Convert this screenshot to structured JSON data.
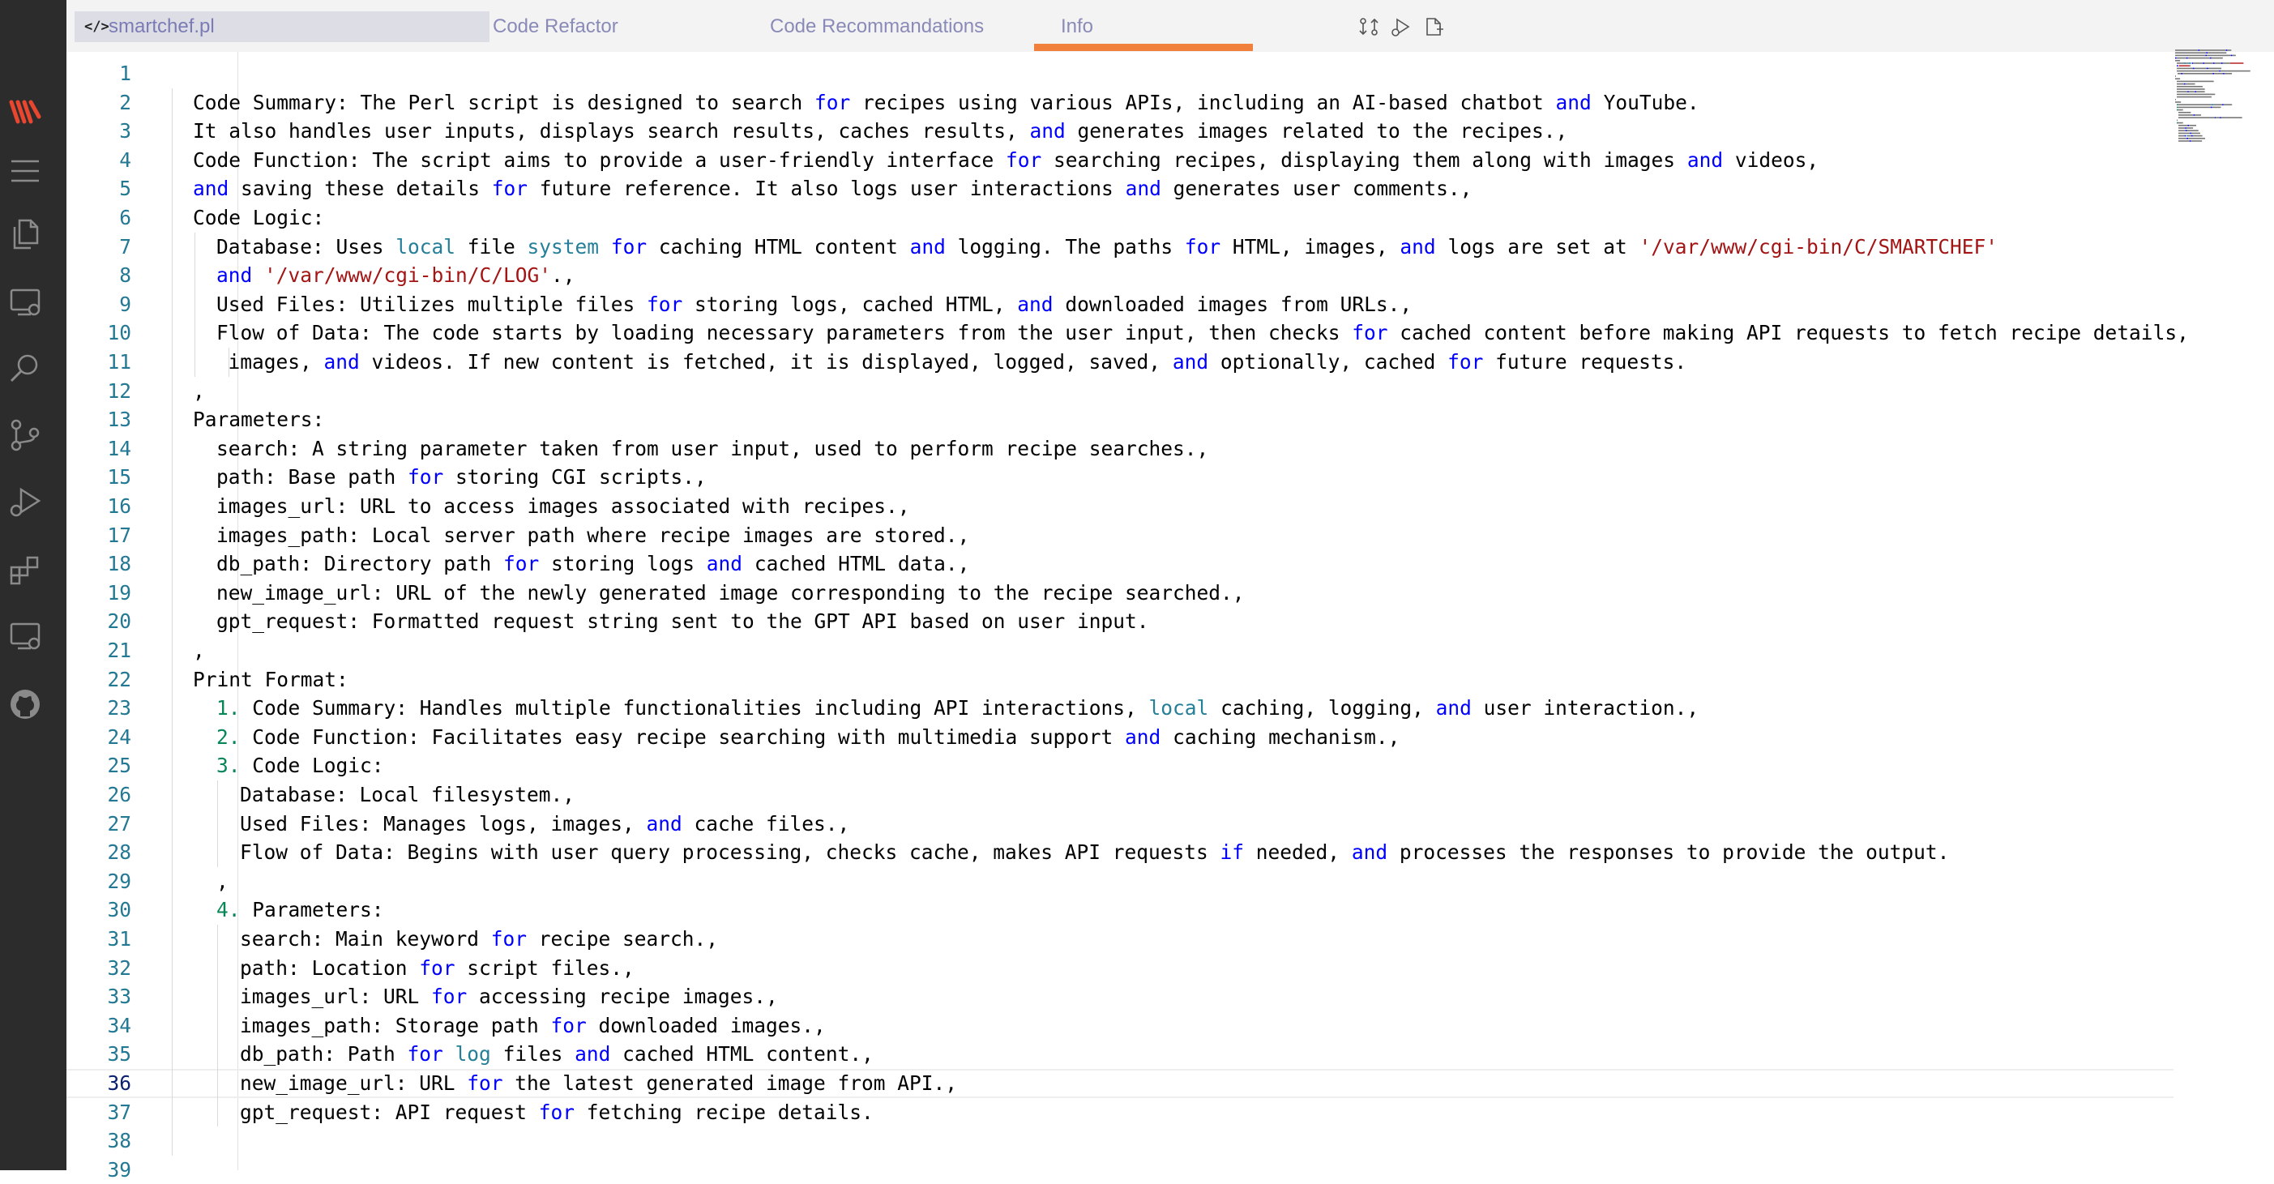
{
  "tabs": {
    "file": {
      "icon": "</>",
      "label": "smartchef.pl"
    },
    "items": [
      {
        "label": "Code Refactor"
      },
      {
        "label": "Code Recommandations"
      },
      {
        "label": "Info"
      }
    ],
    "active_index": 2
  },
  "colors": {
    "activity_bar": "#2c2c2c",
    "tab_accent": "#f0803c",
    "keyword": "#0000ff",
    "type": "#267f99",
    "string": "#a31515",
    "line_number": "#237893"
  },
  "activity_icons": [
    "logo-icon",
    "menu-icon",
    "explorer-icon",
    "remote-explorer-icon",
    "search-icon",
    "source-control-icon",
    "run-debug-icon",
    "extensions-icon",
    "remote-icon",
    "github-icon"
  ],
  "editor": {
    "current_line": 36,
    "lines": [
      {
        "n": "1",
        "i": 0,
        "t": []
      },
      {
        "n": "2",
        "i": 0,
        "t": [
          [
            "Code Summary: The Perl script is designed to search ",
            ""
          ],
          [
            "for",
            "kw"
          ],
          [
            " recipes using various APIs, including an AI-based chatbot ",
            ""
          ],
          [
            "and",
            "kw"
          ],
          [
            " YouTube.",
            ""
          ]
        ]
      },
      {
        "n": "3",
        "i": 0,
        "t": [
          [
            "It also handles user inputs, displays search results, caches results, ",
            ""
          ],
          [
            "and",
            "kw"
          ],
          [
            " generates images related to the recipes.,",
            ""
          ]
        ]
      },
      {
        "n": "4",
        "i": 0,
        "t": [
          [
            "Code Function: The script aims to provide a user-friendly interface ",
            ""
          ],
          [
            "for",
            "kw"
          ],
          [
            " searching recipes, displaying them along with images ",
            ""
          ],
          [
            "and",
            "kw"
          ],
          [
            " videos,",
            ""
          ]
        ]
      },
      {
        "n": "5",
        "i": 0,
        "t": [
          [
            "and",
            "kw"
          ],
          [
            " saving these details ",
            ""
          ],
          [
            "for",
            "kw"
          ],
          [
            " future reference. It also logs user interactions ",
            ""
          ],
          [
            "and",
            "kw"
          ],
          [
            " generates user comments.,",
            ""
          ]
        ]
      },
      {
        "n": "6",
        "i": 0,
        "t": [
          [
            "Code Logic:",
            ""
          ]
        ]
      },
      {
        "n": "7",
        "i": 1,
        "t": [
          [
            "Database: Uses ",
            ""
          ],
          [
            "local",
            "tp"
          ],
          [
            " file ",
            ""
          ],
          [
            "system",
            "tp"
          ],
          [
            " ",
            ""
          ],
          [
            "for",
            "kw"
          ],
          [
            " caching HTML content ",
            ""
          ],
          [
            "and",
            "kw"
          ],
          [
            " logging. The paths ",
            ""
          ],
          [
            "for",
            "kw"
          ],
          [
            " HTML, images, ",
            ""
          ],
          [
            "and",
            "kw"
          ],
          [
            " logs are set at ",
            ""
          ],
          [
            "'/var/www/cgi-bin/C/SMARTCHEF'",
            "str"
          ]
        ]
      },
      {
        "n": "8",
        "i": 1,
        "t": [
          [
            "and",
            "kw"
          ],
          [
            " ",
            ""
          ],
          [
            "'/var/www/cgi-bin/C/LOG'",
            "str"
          ],
          [
            ".,",
            ""
          ]
        ]
      },
      {
        "n": "9",
        "i": 1,
        "t": [
          [
            "Used Files: Utilizes multiple files ",
            ""
          ],
          [
            "for",
            "kw"
          ],
          [
            " storing logs, cached HTML, ",
            ""
          ],
          [
            "and",
            "kw"
          ],
          [
            " downloaded images from URLs.,",
            ""
          ]
        ]
      },
      {
        "n": "10",
        "i": 1,
        "t": [
          [
            "Flow of Data: The code starts by loading necessary parameters from the user input, then checks ",
            ""
          ],
          [
            "for",
            "kw"
          ],
          [
            " cached content before making API requests to fetch recipe details,",
            ""
          ]
        ]
      },
      {
        "n": "11",
        "i": 1.5,
        "t": [
          [
            "images, ",
            ""
          ],
          [
            "and",
            "kw"
          ],
          [
            " videos. If new content is fetched, it is displayed, logged, saved, ",
            ""
          ],
          [
            "and",
            "kw"
          ],
          [
            " optionally, cached ",
            ""
          ],
          [
            "for",
            "kw"
          ],
          [
            " future requests.",
            ""
          ]
        ]
      },
      {
        "n": "12",
        "i": 0,
        "t": [
          [
            ",",
            ""
          ]
        ]
      },
      {
        "n": "13",
        "i": 0,
        "t": [
          [
            "Parameters:",
            ""
          ]
        ]
      },
      {
        "n": "14",
        "i": 1,
        "t": [
          [
            "search: A string parameter taken from user input, used to perform recipe searches.,",
            ""
          ]
        ]
      },
      {
        "n": "15",
        "i": 1,
        "t": [
          [
            "path: Base path ",
            ""
          ],
          [
            "for",
            "kw"
          ],
          [
            " storing CGI scripts.,",
            ""
          ]
        ]
      },
      {
        "n": "16",
        "i": 1,
        "t": [
          [
            "images_url: URL to access images associated with recipes.,",
            ""
          ]
        ]
      },
      {
        "n": "17",
        "i": 1,
        "t": [
          [
            "images_path: Local server path where recipe images are stored.,",
            ""
          ]
        ]
      },
      {
        "n": "18",
        "i": 1,
        "t": [
          [
            "db_path: Directory path ",
            ""
          ],
          [
            "for",
            "kw"
          ],
          [
            " storing logs ",
            ""
          ],
          [
            "and",
            "kw"
          ],
          [
            " cached HTML data.,",
            ""
          ]
        ]
      },
      {
        "n": "19",
        "i": 1,
        "t": [
          [
            "new_image_url: URL of the newly generated image corresponding to the recipe searched.,",
            ""
          ]
        ]
      },
      {
        "n": "20",
        "i": 1,
        "t": [
          [
            "gpt_request: Formatted request string sent to the GPT API based on user input.",
            ""
          ]
        ]
      },
      {
        "n": "21",
        "i": 0,
        "t": [
          [
            ",",
            ""
          ]
        ]
      },
      {
        "n": "22",
        "i": 0,
        "t": [
          [
            "Print Format:",
            ""
          ]
        ]
      },
      {
        "n": "23",
        "i": 1,
        "t": [
          [
            "1.",
            "num"
          ],
          [
            " Code Summary: Handles multiple functionalities including API interactions, ",
            ""
          ],
          [
            "local",
            "tp"
          ],
          [
            " caching, logging, ",
            ""
          ],
          [
            "and",
            "kw"
          ],
          [
            " user interaction.,",
            ""
          ]
        ]
      },
      {
        "n": "24",
        "i": 1,
        "t": [
          [
            "2.",
            "num"
          ],
          [
            " Code Function: Facilitates easy recipe searching with multimedia support ",
            ""
          ],
          [
            "and",
            "kw"
          ],
          [
            " caching mechanism.,",
            ""
          ]
        ]
      },
      {
        "n": "25",
        "i": 1,
        "t": [
          [
            "3.",
            "num"
          ],
          [
            " Code Logic:",
            ""
          ]
        ]
      },
      {
        "n": "26",
        "i": 2,
        "t": [
          [
            "Database: Local filesystem.,",
            ""
          ]
        ]
      },
      {
        "n": "27",
        "i": 2,
        "t": [
          [
            "Used Files: Manages logs, images, ",
            ""
          ],
          [
            "and",
            "kw"
          ],
          [
            " cache files.,",
            ""
          ]
        ]
      },
      {
        "n": "28",
        "i": 2,
        "t": [
          [
            "Flow of Data: Begins with user query processing, checks cache, makes API requests ",
            ""
          ],
          [
            "if",
            "kw"
          ],
          [
            " needed, ",
            ""
          ],
          [
            "and",
            "kw"
          ],
          [
            " processes the responses to provide the output.",
            ""
          ]
        ]
      },
      {
        "n": "29",
        "i": 1,
        "t": [
          [
            ",",
            ""
          ]
        ]
      },
      {
        "n": "30",
        "i": 1,
        "t": [
          [
            "4.",
            "num"
          ],
          [
            " Parameters:",
            ""
          ]
        ]
      },
      {
        "n": "31",
        "i": 2,
        "t": [
          [
            "search: Main keyword ",
            ""
          ],
          [
            "for",
            "kw"
          ],
          [
            " recipe search.,",
            ""
          ]
        ]
      },
      {
        "n": "32",
        "i": 2,
        "t": [
          [
            "path: Location ",
            ""
          ],
          [
            "for",
            "kw"
          ],
          [
            " script files.,",
            ""
          ]
        ]
      },
      {
        "n": "33",
        "i": 2,
        "t": [
          [
            "images_url: URL ",
            ""
          ],
          [
            "for",
            "kw"
          ],
          [
            " accessing recipe images.,",
            ""
          ]
        ]
      },
      {
        "n": "34",
        "i": 2,
        "t": [
          [
            "images_path: Storage path ",
            ""
          ],
          [
            "for",
            "kw"
          ],
          [
            " downloaded images.,",
            ""
          ]
        ]
      },
      {
        "n": "35",
        "i": 2,
        "t": [
          [
            "db_path: Path ",
            ""
          ],
          [
            "for",
            "kw"
          ],
          [
            " ",
            ""
          ],
          [
            "log",
            "tp"
          ],
          [
            " files ",
            ""
          ],
          [
            "and",
            "kw"
          ],
          [
            " cached HTML content.,",
            ""
          ]
        ]
      },
      {
        "n": "36",
        "i": 2,
        "t": [
          [
            "new_image_url: URL ",
            ""
          ],
          [
            "for",
            "kw"
          ],
          [
            " the latest generated image from API.,",
            ""
          ]
        ]
      },
      {
        "n": "37",
        "i": 2,
        "t": [
          [
            "gpt_request: API request ",
            ""
          ],
          [
            "for",
            "kw"
          ],
          [
            " fetching recipe details.",
            ""
          ]
        ]
      },
      {
        "n": "38",
        "i": 0,
        "t": []
      },
      {
        "n": "39",
        "i": 0,
        "t": []
      }
    ]
  }
}
